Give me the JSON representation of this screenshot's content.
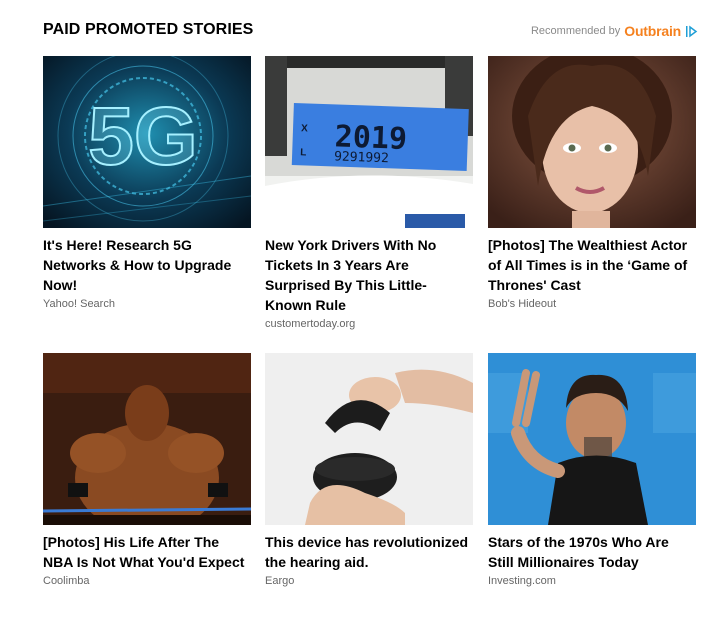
{
  "header": {
    "title": "PAID PROMOTED STORIES",
    "recommended_label": "Recommended by",
    "brand": "Outbrain",
    "brand_color": "#f5811f"
  },
  "cards": [
    {
      "title": "It's Here! Research 5G Networks & How to Upgrade Now!",
      "source": "Yahoo! Search",
      "image": "5g-network-graphic"
    },
    {
      "title": "New York Drivers With No Tickets In 3 Years Are Surprised By This Little-Known Rule",
      "source": "customertoday.org",
      "image": "license-plate-sticker",
      "sticker_year": "2019",
      "sticker_number": "9291992"
    },
    {
      "title": "[Photos] The Wealthiest Actor of All Times is in the ‘Game of Thrones' Cast",
      "source": "Bob's Hideout",
      "image": "actress-portrait"
    },
    {
      "title": "[Photos] His Life After The NBA Is Not What You'd Expect",
      "source": "Coolimba",
      "image": "wrestler-photo"
    },
    {
      "title": "This device has revolutionized the hearing aid.",
      "source": "Eargo",
      "image": "hearing-aid-case"
    },
    {
      "title": "Stars of the 1970s Who Are Still Millionaires Today",
      "source": "Investing.com",
      "image": "actor-peace-sign"
    }
  ]
}
